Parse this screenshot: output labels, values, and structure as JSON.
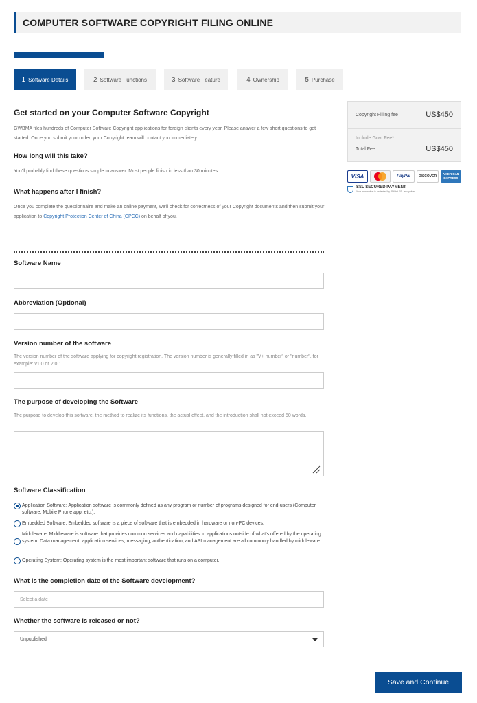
{
  "header": {
    "title": "COMPUTER SOFTWARE COPYRIGHT FILING ONLINE"
  },
  "progress": {
    "fraction": 0.2
  },
  "steps": [
    {
      "num": "1",
      "label": "Software Details",
      "active": true
    },
    {
      "num": "2",
      "label": "Software Functions",
      "active": false
    },
    {
      "num": "3",
      "label": "Software Feature",
      "active": false
    },
    {
      "num": "4",
      "label": "Ownership",
      "active": false
    },
    {
      "num": "5",
      "label": "Purchase",
      "active": false
    }
  ],
  "intro": {
    "title": "Get started on your Computer Software Copyright",
    "text": "GWBMA files hundreds of Computer Software Copyright applications for foreign clients every year. Please answer a few short questions to get started. Once you submit your order, your Copyright team will contact you immediately.",
    "q1_title": "How long will this take?",
    "q1_text": "You'll probably find these questions simple to answer. Most people finish in less than 30 minutes.",
    "q2_title": "What happens after I finish?",
    "q2_text": "Once you complete the questionnaire and make an online payment, we'll check for correctness of your Copyright documents and then submit your application to",
    "q2_link": "Copyright Protection Center of China (CPCC)",
    "q2_tail": "on behalf of you."
  },
  "fees": {
    "filing_label": "Copyright Filling fee",
    "filing_value": "US$450",
    "govt_label": "Include Govt Fee*",
    "total_label": "Total Fee",
    "total_value": "US$450"
  },
  "payment": {
    "visa": "VISA",
    "paypal": "PayPal",
    "discover": "DISCOVER",
    "amex": "AMERICAN EXPRESS",
    "ssl_title": "SSL SECURED PAYMENT",
    "ssl_sub": "Your information is protected by 256-bit SSL encryption"
  },
  "form": {
    "software_name_label": "Software Name",
    "abbreviation_label": "Abbreviation (Optional)",
    "version_label": "Version number of the software",
    "version_help": "The version number of the software applying for copyright registration. The version number is generally filled in as \"V+ number\" or \"number\", for example: v1.0 or 2.0.1",
    "purpose_label": "The purpose of developing the Software",
    "purpose_help": "The purpose to develop this software, the method to realize its functions, the actual effect, and the introduction shall not exceed 50 words.",
    "classification_label": "Software Classification",
    "classification_options": [
      "Application Software: Application software is commonly defined as any program or number of programs designed for end-users (Computer software, Mobile Phone app, etc.).",
      "Embedded Software: Embedded software is a piece of software that is embedded in hardware or non-PC devices.",
      "Middleware: Middleware is software that provides common services and capabilities to applications outside of what's offered by the operating system. Data management, application services, messaging, authentication, and API management are all commonly handled by middleware.",
      "Operating System: Operating system is the most important software that runs on a computer."
    ],
    "classification_selected": 0,
    "date_label": "What is the completion date of the Software development?",
    "date_placeholder": "Select a date",
    "released_label": "Whether the software is released or not?",
    "released_value": "Unpublished"
  },
  "actions": {
    "save_label": "Save and Continue"
  }
}
